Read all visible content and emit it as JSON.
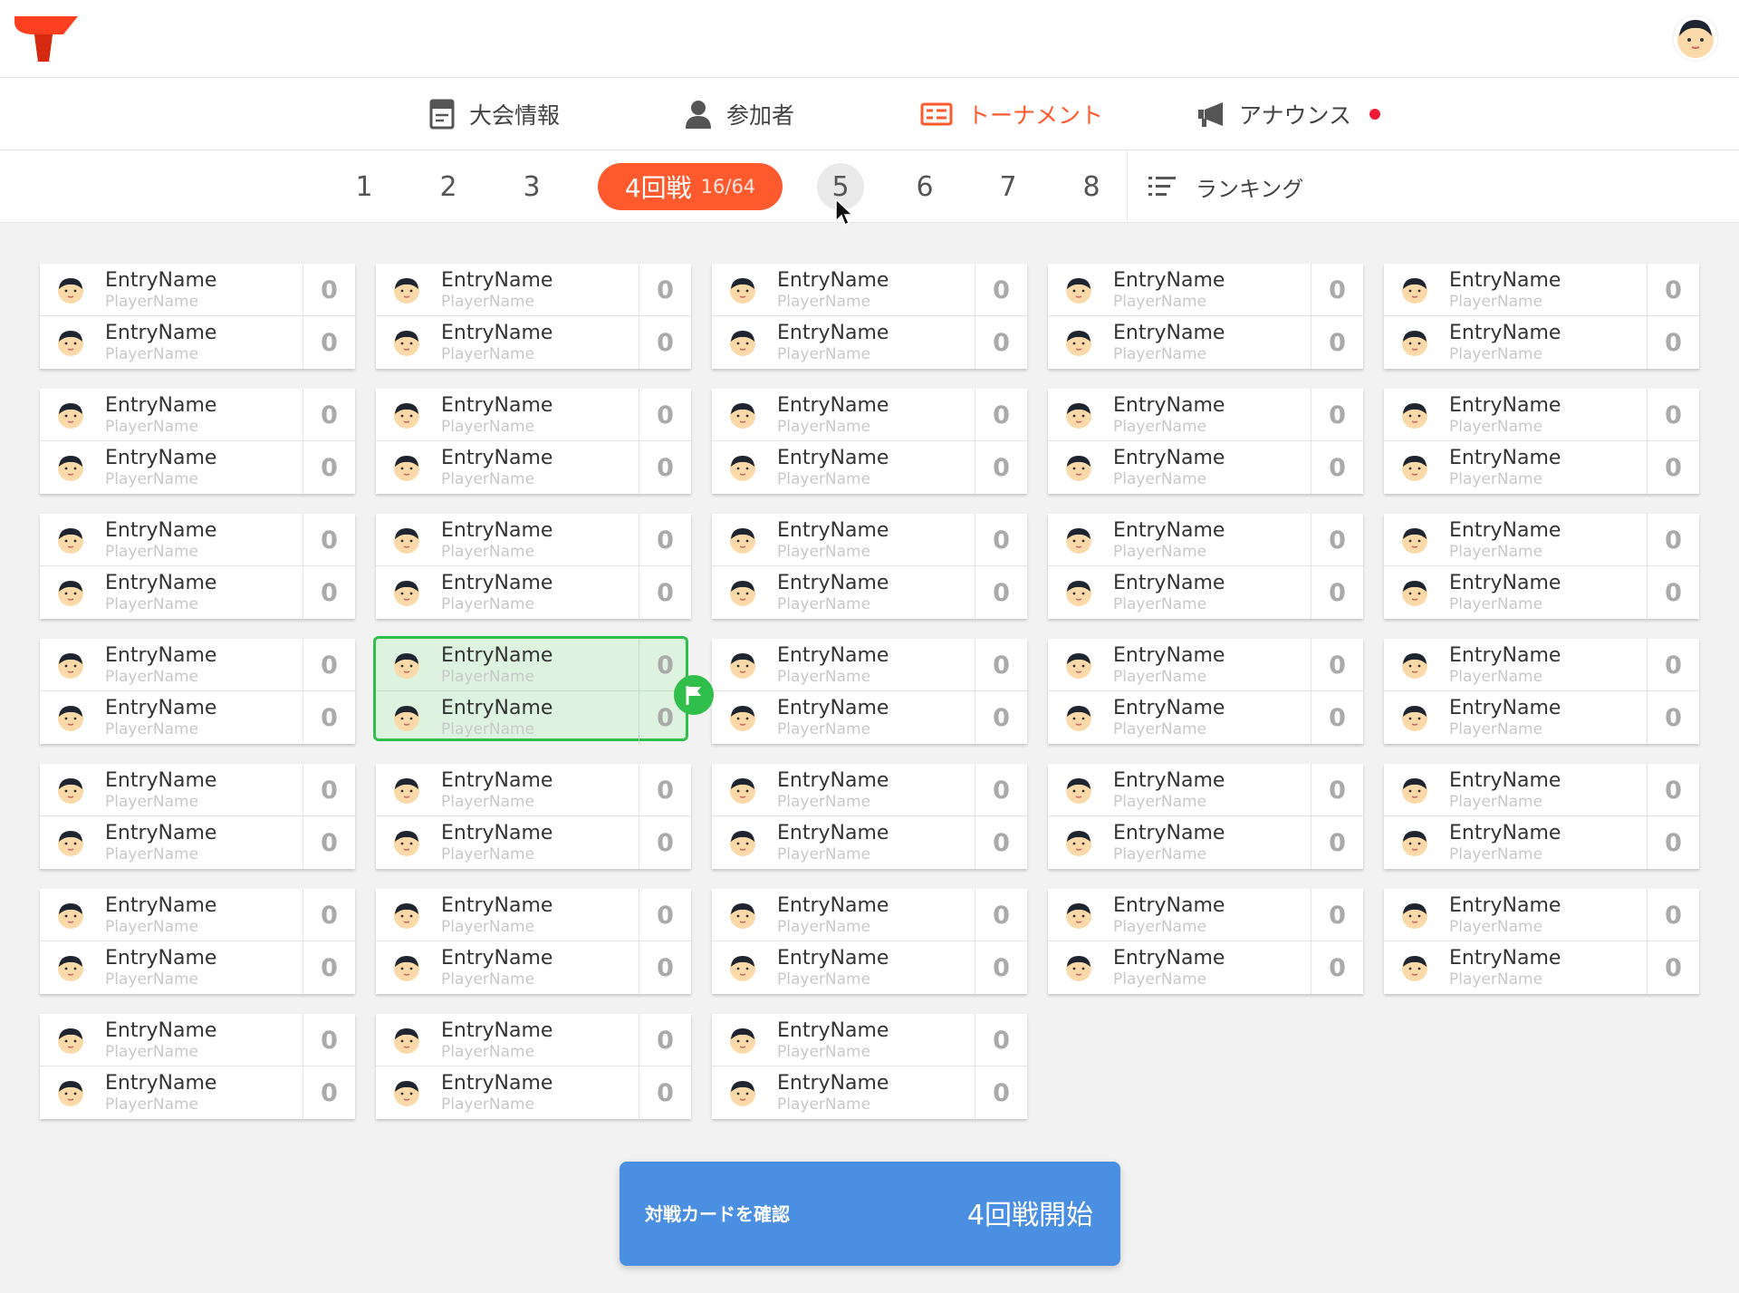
{
  "header": {
    "logo": "app-logo",
    "avatar": "user-avatar"
  },
  "main_tabs": [
    {
      "label": "大会情報",
      "icon": "document-icon",
      "active": false
    },
    {
      "label": "参加者",
      "icon": "person-icon",
      "active": false
    },
    {
      "label": "トーナメント",
      "icon": "bracket-icon",
      "active": true
    },
    {
      "label": "アナウンス",
      "icon": "megaphone-icon",
      "active": false,
      "notification_dot": true
    }
  ],
  "rounds": {
    "items": [
      "1",
      "2",
      "3",
      "4",
      "5",
      "6",
      "7",
      "8"
    ],
    "active_label": "4回戦",
    "active_count": "16/64",
    "hovered": "5",
    "ranking_label": "ランキング"
  },
  "matches": {
    "entry_name": "EntryName",
    "player_name": "PlayerName",
    "score": "0",
    "columns": 5,
    "count": 33,
    "selected_index": 16
  },
  "footer": {
    "confirm_label": "対戦カードを確認",
    "start_label": "4回戦開始"
  },
  "colors": {
    "accent": "#ff5a2e",
    "selected_border": "#2fbf4a",
    "selected_fill": "#ddf2df",
    "primary_button": "#4a8fe2",
    "notification": "#ef1b3a"
  }
}
